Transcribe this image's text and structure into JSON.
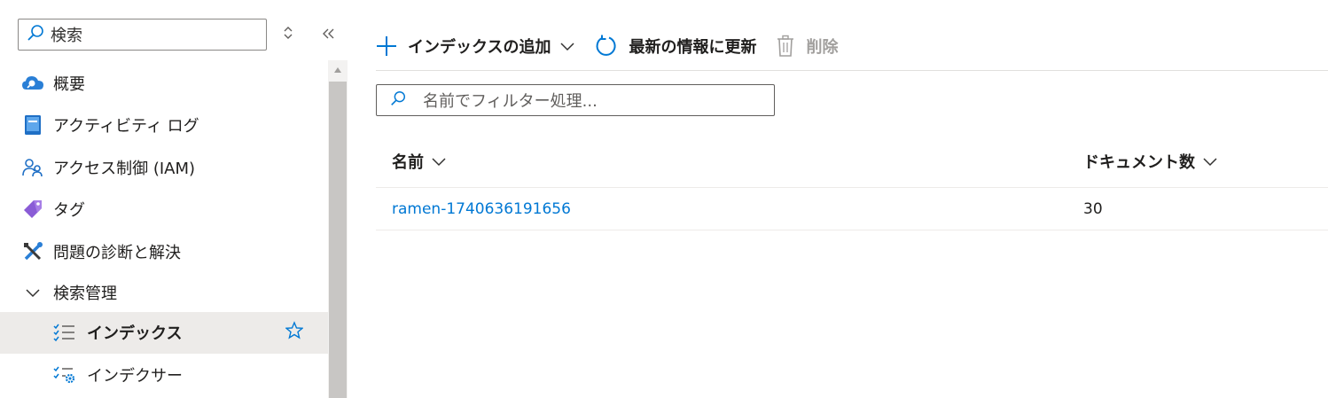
{
  "sidebar": {
    "search": {
      "placeholder": "検索"
    },
    "items": [
      {
        "label": "概要",
        "icon": "cloud-search-icon"
      },
      {
        "label": "アクティビティ ログ",
        "icon": "book-icon"
      },
      {
        "label": "アクセス制御 (IAM)",
        "icon": "people-icon"
      },
      {
        "label": "タグ",
        "icon": "tag-icon"
      },
      {
        "label": "問題の診断と解決",
        "icon": "wrench-icon"
      }
    ],
    "group": {
      "label": "検索管理",
      "expanded": true
    },
    "children": [
      {
        "label": "インデックス",
        "icon": "checklist-icon",
        "active": true,
        "favorite": true
      },
      {
        "label": "インデクサー",
        "icon": "indexer-gear-icon",
        "active": false
      }
    ]
  },
  "toolbar": {
    "add_label": "インデックスの追加",
    "refresh_label": "最新の情報に更新",
    "delete_label": "削除"
  },
  "filter": {
    "placeholder": "名前でフィルター処理..."
  },
  "table": {
    "columns": [
      "名前",
      "ドキュメント数"
    ],
    "rows": [
      {
        "name": "ramen-1740636191656",
        "count": "30"
      }
    ]
  },
  "colors": {
    "accent": "#0078d4",
    "active_bg": "#edebe9",
    "disabled": "#a19f9d"
  }
}
